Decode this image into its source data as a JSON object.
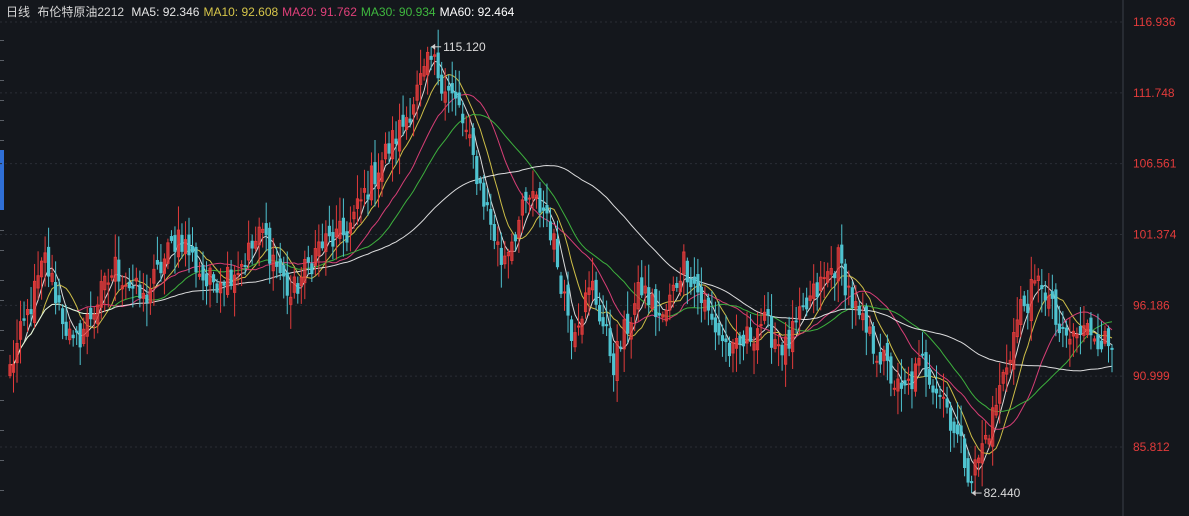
{
  "header": {
    "period": "日线",
    "instrument": "布伦特原油2212",
    "ma_labels": [
      {
        "name": "MA5",
        "value": "92.346",
        "color": "#e6e6e6"
      },
      {
        "name": "MA10",
        "value": "92.608",
        "color": "#d7c64a"
      },
      {
        "name": "MA20",
        "value": "91.762",
        "color": "#e0407a"
      },
      {
        "name": "MA30",
        "value": "90.934",
        "color": "#3fb83f"
      },
      {
        "name": "MA60",
        "value": "92.464",
        "color": "#ffffff"
      }
    ]
  },
  "colors": {
    "background": "#14171c",
    "grid": "#2a2e35",
    "up": "#e23b3b",
    "down": "#4fc3d0",
    "axis_text": "#e23b3b"
  },
  "chart_data": {
    "type": "candlestick",
    "y_ticks": [
      "116.936",
      "111.748",
      "106.561",
      "101.374",
      "96.186",
      "90.999",
      "85.812"
    ],
    "ylim": [
      82.0,
      117.5
    ],
    "grid": true,
    "annotations": [
      {
        "label": "115.120",
        "value": 115.12,
        "bar_index": 120,
        "side": "right"
      },
      {
        "label": "82.440",
        "value": 82.44,
        "bar_index": 274,
        "side": "right"
      }
    ],
    "bar_count": 315,
    "anchors": [
      {
        "i": 0,
        "close": 91.5
      },
      {
        "i": 10,
        "close": 99.5
      },
      {
        "i": 18,
        "close": 93.0
      },
      {
        "i": 30,
        "close": 99.0
      },
      {
        "i": 38,
        "close": 96.5
      },
      {
        "i": 48,
        "close": 101.5
      },
      {
        "i": 56,
        "close": 97.8
      },
      {
        "i": 65,
        "close": 99.0
      },
      {
        "i": 72,
        "close": 101.5
      },
      {
        "i": 80,
        "close": 96.8
      },
      {
        "i": 88,
        "close": 100.5
      },
      {
        "i": 96,
        "close": 101.5
      },
      {
        "i": 104,
        "close": 106.0
      },
      {
        "i": 112,
        "close": 109.5
      },
      {
        "i": 120,
        "close": 114.2
      },
      {
        "i": 128,
        "close": 110.5
      },
      {
        "i": 134,
        "close": 105.0
      },
      {
        "i": 140,
        "close": 99.5
      },
      {
        "i": 148,
        "close": 104.0
      },
      {
        "i": 153,
        "close": 103.0
      },
      {
        "i": 160,
        "close": 94.5
      },
      {
        "i": 166,
        "close": 97.5
      },
      {
        "i": 172,
        "close": 92.0
      },
      {
        "i": 180,
        "close": 97.5
      },
      {
        "i": 186,
        "close": 95.0
      },
      {
        "i": 192,
        "close": 99.5
      },
      {
        "i": 200,
        "close": 95.0
      },
      {
        "i": 206,
        "close": 92.5
      },
      {
        "i": 214,
        "close": 95.0
      },
      {
        "i": 221,
        "close": 93.0
      },
      {
        "i": 228,
        "close": 96.5
      },
      {
        "i": 236,
        "close": 99.5
      },
      {
        "i": 242,
        "close": 95.0
      },
      {
        "i": 248,
        "close": 92.5
      },
      {
        "i": 254,
        "close": 89.5
      },
      {
        "i": 260,
        "close": 92.0
      },
      {
        "i": 266,
        "close": 89.5
      },
      {
        "i": 274,
        "close": 83.5
      },
      {
        "i": 280,
        "close": 88.0
      },
      {
        "i": 288,
        "close": 96.0
      },
      {
        "i": 294,
        "close": 98.0
      },
      {
        "i": 300,
        "close": 93.5
      },
      {
        "i": 308,
        "close": 94.5
      },
      {
        "i": 314,
        "close": 93.0
      }
    ]
  }
}
